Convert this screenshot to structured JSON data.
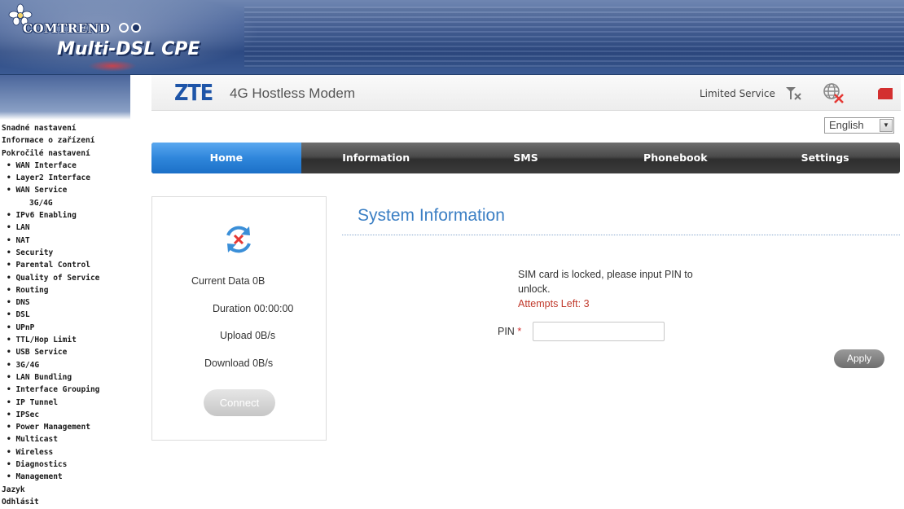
{
  "banner": {
    "brand": "COMTREND",
    "product": "Multi-DSL CPE"
  },
  "menu": [
    {
      "label": "Snadné nastavení",
      "level": 0
    },
    {
      "label": "Informace o zařízení",
      "level": 0
    },
    {
      "label": "Pokročilé nastavení",
      "level": 0
    },
    {
      "label": "• WAN Interface",
      "level": 1
    },
    {
      "label": "• Layer2 Interface",
      "level": 1
    },
    {
      "label": "• WAN Service",
      "level": 1
    },
    {
      "label": "3G/4G",
      "level": 2
    },
    {
      "label": "• IPv6 Enabling",
      "level": 1
    },
    {
      "label": "• LAN",
      "level": 1
    },
    {
      "label": "• NAT",
      "level": 1
    },
    {
      "label": "• Security",
      "level": 1
    },
    {
      "label": "• Parental Control",
      "level": 1
    },
    {
      "label": "• Quality of Service",
      "level": 1
    },
    {
      "label": "• Routing",
      "level": 1
    },
    {
      "label": "• DNS",
      "level": 1
    },
    {
      "label": "• DSL",
      "level": 1
    },
    {
      "label": "• UPnP",
      "level": 1
    },
    {
      "label": "• TTL/Hop Limit",
      "level": 1
    },
    {
      "label": "• USB Service",
      "level": 1
    },
    {
      "label": "• 3G/4G",
      "level": 1
    },
    {
      "label": "• LAN Bundling",
      "level": 1
    },
    {
      "label": "• Interface Grouping",
      "level": 1
    },
    {
      "label": "• IP Tunnel",
      "level": 1
    },
    {
      "label": "• IPSec",
      "level": 1
    },
    {
      "label": "• Power Management",
      "level": 1
    },
    {
      "label": "• Multicast",
      "level": 1
    },
    {
      "label": "• Wireless",
      "level": 1
    },
    {
      "label": "• Diagnostics",
      "level": 1
    },
    {
      "label": "• Management",
      "level": 1
    },
    {
      "label": "Jazyk",
      "level": 0
    },
    {
      "label": "Odhlásit",
      "level": 0
    }
  ],
  "modem_header": {
    "logo": "ZTE",
    "title": "4G Hostless Modem",
    "status": "Limited Service",
    "icons": [
      "signal-no-service-icon",
      "globe-disconnected-icon",
      "sim-card-icon"
    ],
    "alert_color": "#e53935"
  },
  "language": {
    "selected": "English"
  },
  "nav": {
    "tabs": [
      "Home",
      "Information",
      "SMS",
      "Phonebook",
      "Settings"
    ],
    "active": "Home",
    "active_color": "#2f86db"
  },
  "status_panel": {
    "icon": "refresh-disconnected-icon",
    "current_data": "Current Data 0B",
    "duration": "Duration 00:00:00",
    "upload": "Upload 0B/s",
    "download": "Download 0B/s",
    "connect_label": "Connect"
  },
  "system_info": {
    "title": "System Information",
    "message": "SIM card is locked, please input PIN to unlock.",
    "attempts": "Attempts Left: 3",
    "pin_label": "PIN",
    "required_mark": "*",
    "pin_value": "",
    "apply_label": "Apply",
    "title_color": "#3b7fc4"
  }
}
